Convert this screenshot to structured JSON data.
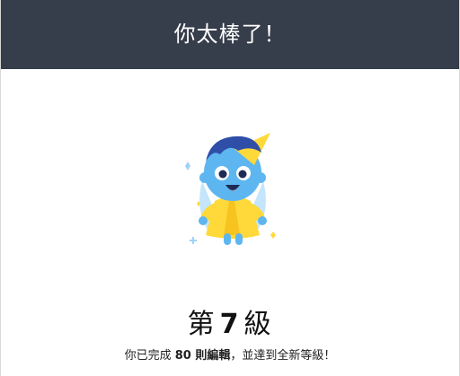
{
  "header": {
    "title": "你太棒了！"
  },
  "illustration": {
    "icon": "blue-wizard-mascot-icon"
  },
  "level": {
    "prefix": "第",
    "number": "7",
    "suffix": "級"
  },
  "message": {
    "before": "你已完成 ",
    "highlight": "80 則編輯",
    "after": "，並達到全新等級！"
  },
  "colors": {
    "header_bg": "#363d4b",
    "mascot_blue": "#5eb6f0",
    "hat_yellow": "#ffd93a",
    "hair_navy": "#2f4ea8"
  }
}
